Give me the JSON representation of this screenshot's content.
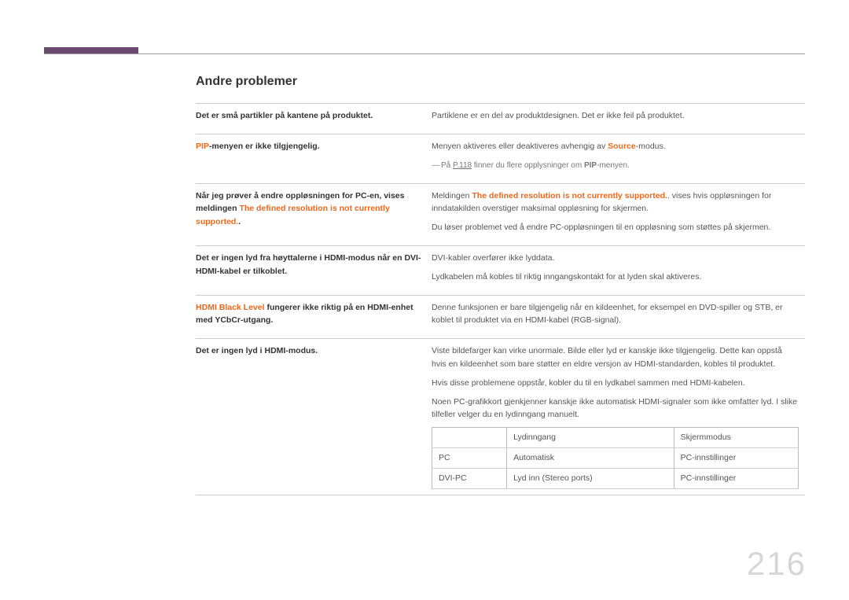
{
  "page_number": "216",
  "section_title": "Andre problemer",
  "rows": [
    {
      "left": [
        {
          "t": "Det er små partikler på kantene på produktet."
        }
      ],
      "right": [
        {
          "p": [
            {
              "t": "Partiklene er en del av produktdesignen. Det er ikke feil på produktet."
            }
          ]
        }
      ]
    },
    {
      "left": [
        {
          "t": "PIP",
          "orange": true
        },
        {
          "t": "-menyen er ikke tilgjengelig."
        }
      ],
      "right": [
        {
          "p": [
            {
              "t": "Menyen aktiveres eller deaktiveres avhengig av "
            },
            {
              "t": "Source",
              "orange": true
            },
            {
              "t": "-modus."
            }
          ]
        },
        {
          "p": [
            {
              "t": "― ",
              "dash": true
            },
            {
              "t": "På ",
              "sub": true
            },
            {
              "t": "P.118",
              "link": true,
              "sub": true
            },
            {
              "t": " finner du flere opplysninger om ",
              "sub": true
            },
            {
              "t": "PIP",
              "orange": true,
              "sub": true
            },
            {
              "t": "-menyen.",
              "sub": true
            }
          ]
        }
      ]
    },
    {
      "left": [
        {
          "t": "Når jeg prøver å endre oppløsningen for PC-en, vises meldingen "
        },
        {
          "t": "The defined resolution is not currently supported.",
          "orange": true
        },
        {
          "t": "."
        }
      ],
      "right": [
        {
          "p": [
            {
              "t": "Meldingen  "
            },
            {
              "t": "The defined resolution is not currently supported.",
              "orange": true
            },
            {
              "t": ". vises hvis oppløsningen for inndatakilden overstiger maksimal oppløsning for skjermen."
            }
          ]
        },
        {
          "p": [
            {
              "t": "Du løser problemet ved å endre PC-oppløsningen til en oppløsning som støttes på skjermen."
            }
          ]
        }
      ]
    },
    {
      "left": [
        {
          "t": "Det er ingen lyd fra høyttalerne i HDMI-modus når en DVI-HDMI-kabel er tilkoblet."
        }
      ],
      "right": [
        {
          "p": [
            {
              "t": "DVI-kabler overfører ikke lyddata."
            }
          ]
        },
        {
          "p": [
            {
              "t": "Lydkabelen må kobles til riktig inngangskontakt for at lyden skal aktiveres."
            }
          ]
        }
      ]
    },
    {
      "left": [
        {
          "t": "HDMI Black Level",
          "orange": true
        },
        {
          "t": " fungerer ikke riktig på en HDMI-enhet med YCbCr-utgang."
        }
      ],
      "right": [
        {
          "p": [
            {
              "t": "Denne funksjonen er bare tilgjengelig når en kildeenhet, for eksempel en DVD-spiller og STB, er koblet til produktet via en HDMI-kabel (RGB-signal)."
            }
          ]
        }
      ]
    },
    {
      "left": [
        {
          "t": "Det er ingen lyd i HDMI-modus."
        }
      ],
      "right": [
        {
          "p": [
            {
              "t": "Viste bildefarger kan virke unormale. Bilde eller lyd er kanskje ikke tilgjengelig. Dette kan oppstå hvis en kildeenhet som bare støtter en eldre versjon av HDMI-standarden, kobles til produktet."
            }
          ]
        },
        {
          "p": [
            {
              "t": "Hvis disse problemene oppstår, kobler du til en lydkabel sammen med HDMI-kabelen."
            }
          ]
        },
        {
          "p": [
            {
              "t": "Noen PC-grafikkort gjenkjenner kanskje ikke automatisk HDMI-signaler som ikke omfatter lyd. I slike tilfeller velger du en lydinngang manuelt."
            }
          ]
        }
      ],
      "inner_table": {
        "headers": [
          "",
          "Lydinngang",
          "Skjermmodus"
        ],
        "rows": [
          [
            "PC",
            "Automatisk",
            "PC-innstillinger"
          ],
          [
            "DVI-PC",
            "Lyd inn (Stereo ports)",
            "PC-innstillinger"
          ]
        ]
      }
    }
  ]
}
